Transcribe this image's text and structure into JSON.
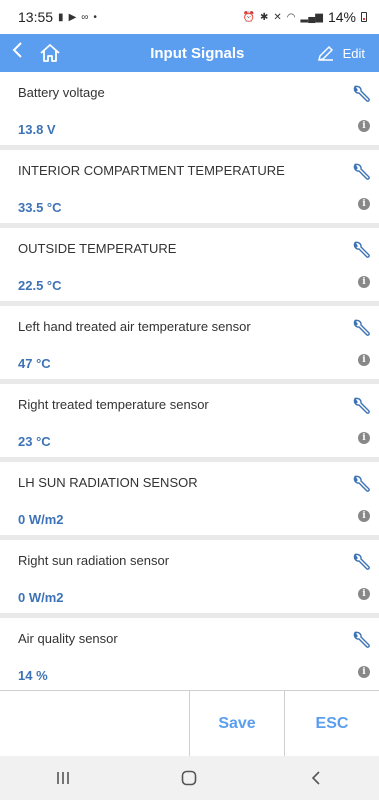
{
  "status_bar": {
    "time": "13:55",
    "battery": "14%"
  },
  "header": {
    "title": "Input Signals",
    "edit_label": "Edit"
  },
  "signals": [
    {
      "label": "Battery voltage",
      "value": "13.8 V"
    },
    {
      "label": "INTERIOR COMPARTMENT TEMPERATURE",
      "value": "33.5 °C"
    },
    {
      "label": "OUTSIDE TEMPERATURE",
      "value": "22.5 °C"
    },
    {
      "label": "Left hand treated air temperature sensor",
      "value": "47 °C"
    },
    {
      "label": "Right treated temperature sensor",
      "value": "23 °C"
    },
    {
      "label": "LH SUN RADIATION SENSOR",
      "value": "0 W/m2"
    },
    {
      "label": "Right sun radiation sensor",
      "value": "0 W/m2"
    },
    {
      "label": "Air quality sensor",
      "value": "14 %"
    }
  ],
  "footer": {
    "save_label": "Save",
    "esc_label": "ESC"
  },
  "colors": {
    "accent": "#5b9ef0",
    "value_text": "#3d73b6"
  },
  "icons": [
    "back-icon",
    "home-icon",
    "edit-icon",
    "wrench-icon",
    "info-icon",
    "recents-icon",
    "home-nav-icon",
    "back-nav-icon"
  ]
}
